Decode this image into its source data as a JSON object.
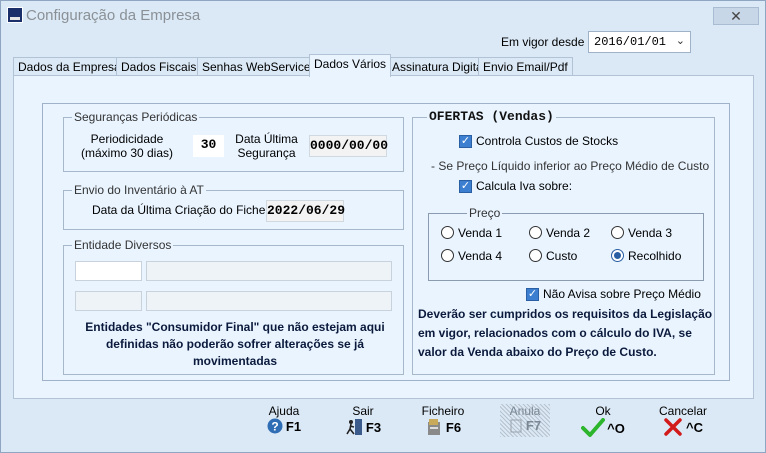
{
  "window": {
    "title": "Configuração da Empresa",
    "close": "✕"
  },
  "header": {
    "vigor_label": "Em vigor desde :",
    "vigor_value": "2016/01/01"
  },
  "tabs": [
    "Dados da Empresa",
    "Dados Fiscais",
    "Senhas WebServices",
    "Dados Vários",
    "Assinatura Digital",
    "Envio Email/Pdf"
  ],
  "active_tab": "Dados Vários",
  "seguranca": {
    "title": "Seguranças Periódicas",
    "periodicidade_label": [
      "Periodicidade",
      "(máximo 30 dias)"
    ],
    "periodicidade_value": "30",
    "data_label": [
      "Data Última",
      "Segurança"
    ],
    "data_value": "0000/00/00"
  },
  "inventario": {
    "title": "Envio do Inventário à AT",
    "label": "Data da Última Criação do Ficheiro",
    "value": "2022/06/29"
  },
  "entidade": {
    "title": "Entidade Diversos",
    "note": [
      "Entidades \"Consumidor Final\" que não estejam aqui",
      "definidas não poderão sofrer alterações se já",
      "movimentadas"
    ]
  },
  "ofertas": {
    "title": "OFERTAS (Vendas)",
    "controla_label": "Controla Custos de Stocks",
    "controla_checked": true,
    "preco_rule": "- Se Preço Líquido inferior ao Preço Médio de Custo",
    "calcula_label": "Calcula Iva sobre:",
    "calcula_checked": true,
    "preco_title": "Preço",
    "radios": [
      "Venda 1",
      "Venda 2",
      "Venda 3",
      "Venda 4",
      "Custo",
      "Recolhido"
    ],
    "selected": "Recolhido",
    "nao_avisa_label": "Não Avisa sobre Preço Médio",
    "nao_avisa_checked": true,
    "note": [
      "Deverão ser cumpridos os requisitos da Legislação",
      "em vigor, relacionados com o cálculo do IVA, se",
      "valor da Venda abaixo do Preço de Custo."
    ]
  },
  "footer": {
    "buttons": [
      {
        "label": "Ajuda",
        "key": "F1",
        "icon": "help-icon"
      },
      {
        "label": "Sair",
        "key": "F3",
        "icon": "exit-icon"
      },
      {
        "label": "Ficheiro",
        "key": "F6",
        "icon": "file-icon"
      },
      {
        "label": "Anula",
        "key": "F7",
        "icon": "cancel-doc-icon",
        "disabled": true
      },
      {
        "label": "Ok",
        "key": "^O",
        "icon": "checkmark-icon"
      },
      {
        "label": "Cancelar",
        "key": "^C",
        "icon": "x-icon"
      }
    ]
  }
}
